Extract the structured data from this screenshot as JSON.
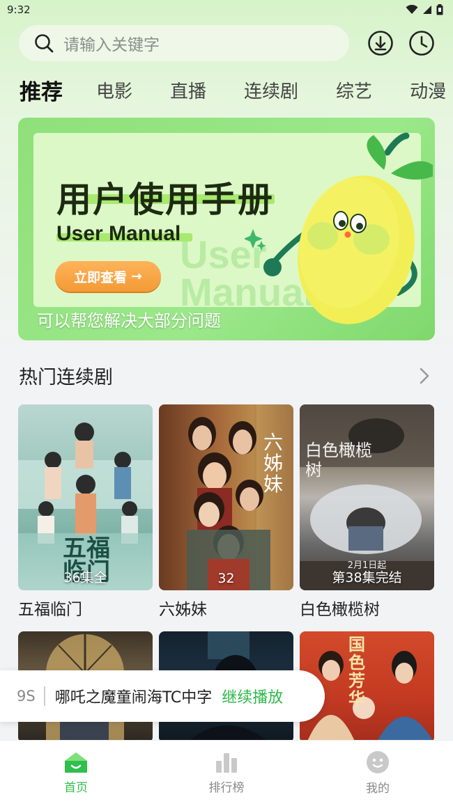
{
  "status_bar": {
    "time": "9:32"
  },
  "search": {
    "placeholder": "请输入关键字"
  },
  "tabs": [
    {
      "label": "推荐",
      "active": true
    },
    {
      "label": "电影"
    },
    {
      "label": "直播"
    },
    {
      "label": "连续剧"
    },
    {
      "label": "综艺"
    },
    {
      "label": "动漫"
    }
  ],
  "banner": {
    "title": "用户使用手册",
    "subtitle": "User Manual",
    "watermark_line1": "User",
    "watermark_line2": "Manual",
    "cta": "立即查看",
    "cta_arrow": "→",
    "caption": "可以帮您解决大部分问题"
  },
  "section": {
    "title": "热门连续剧",
    "more_icon": "chevron-right-icon"
  },
  "shows": [
    {
      "title": "五福临门",
      "badge": "36集全",
      "poster_text": "五福临门"
    },
    {
      "title": "六姊妹",
      "badge": "32",
      "poster_text": "六姊妹"
    },
    {
      "title": "白色橄榄树",
      "badge": "第38集完结",
      "poster_text": "白色橄榄树",
      "poster_date": "2月1日起"
    }
  ],
  "second_row_posters": [
    {
      "poster_text": ""
    },
    {
      "poster_text": ""
    },
    {
      "poster_text": "国色芳华"
    }
  ],
  "continue_watching": {
    "prefix": "9S",
    "title": "哪吒之魔童闹海TC中字",
    "action": "继续播放"
  },
  "bottom_nav": [
    {
      "label": "首页",
      "icon": "home-icon",
      "active": true
    },
    {
      "label": "排行榜",
      "icon": "chart-icon"
    },
    {
      "label": "我的",
      "icon": "profile-icon"
    }
  ],
  "colors": {
    "accent": "#2fbf4c",
    "cta": "#f39a36",
    "banner": "#9be88a"
  }
}
